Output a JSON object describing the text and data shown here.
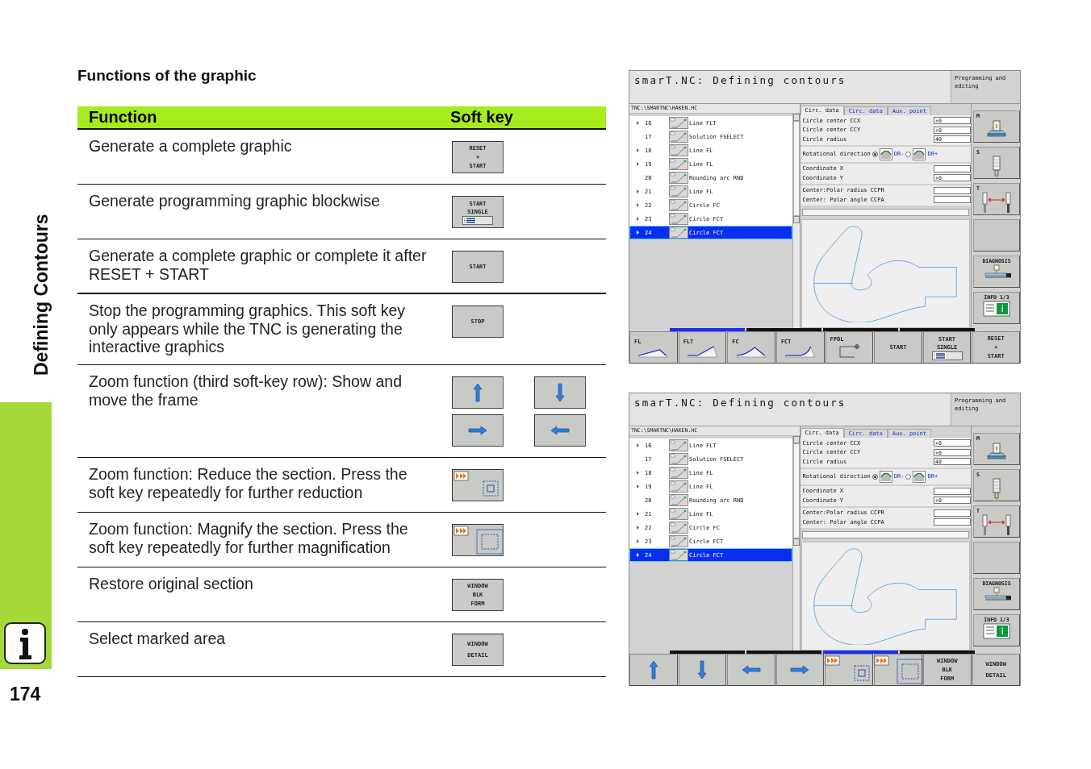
{
  "side_tab": {
    "title": "Defining Contours"
  },
  "page_number": "174",
  "section_title": "Functions of the graphic",
  "table": {
    "columns": [
      "Function",
      "Soft key"
    ],
    "rows": [
      {
        "function": "Generate a complete graphic",
        "softkeys": [
          {
            "kind": "text",
            "lines": [
              "RESET",
              "+",
              "START"
            ]
          }
        ]
      },
      {
        "function": "Generate programming graphic blockwise",
        "softkeys": [
          {
            "kind": "single",
            "lines": [
              "START",
              "SINGLE"
            ]
          }
        ]
      },
      {
        "function": "Generate a complete graphic or complete it after RESET + START",
        "softkeys": [
          {
            "kind": "text",
            "lines": [
              "START"
            ]
          }
        ]
      },
      {
        "function": "Stop the programming graphics. This soft key only appears while the TNC is generating the interactive graphics",
        "softkeys": [
          {
            "kind": "text",
            "lines": [
              "STOP"
            ]
          }
        ]
      },
      {
        "function": "Zoom function (third soft-key row): Show and move the frame",
        "softkeys": [
          {
            "kind": "up"
          },
          {
            "kind": "down"
          },
          {
            "kind": "right"
          },
          {
            "kind": "left"
          }
        ]
      },
      {
        "function": "Zoom function: Reduce the section. Press the soft key repeatedly for further reduction",
        "softkeys": [
          {
            "kind": "reduce"
          }
        ]
      },
      {
        "function": "Zoom function: Magnify the section. Press the soft key repeatedly for further magnification",
        "softkeys": [
          {
            "kind": "magnify"
          }
        ]
      },
      {
        "function": "Restore original section",
        "softkeys": [
          {
            "kind": "text",
            "lines": [
              "WINDOW",
              "BLK",
              "FORM"
            ]
          }
        ]
      },
      {
        "function": "Select marked area",
        "softkeys": [
          {
            "kind": "text",
            "lines": [
              "WINDOW",
              "DETAIL"
            ]
          }
        ]
      }
    ]
  },
  "screens": [
    {
      "title": "smarT.NC: Defining contours",
      "mode": "Programming and editing",
      "path": "TNC:\\SMARTNC\\HAKEN.HC",
      "blocks": [
        {
          "number": "16",
          "label": "Line FLT",
          "expandable": true,
          "selected": false
        },
        {
          "number": "17",
          "label": "Solution FSELECT",
          "expandable": false,
          "selected": false
        },
        {
          "number": "18",
          "label": "Line FL",
          "expandable": true,
          "selected": false
        },
        {
          "number": "19",
          "label": "Line FL",
          "expandable": true,
          "selected": false
        },
        {
          "number": "20",
          "label": "Rounding arc RND",
          "expandable": false,
          "selected": false
        },
        {
          "number": "21",
          "label": "Line FL",
          "expandable": true,
          "selected": false
        },
        {
          "number": "22",
          "label": "Circle FC",
          "expandable": true,
          "selected": false
        },
        {
          "number": "23",
          "label": "Circle FCT",
          "expandable": true,
          "selected": false
        },
        {
          "number": "24",
          "label": "Circle FCT",
          "expandable": true,
          "selected": true
        }
      ],
      "tabs": [
        {
          "label": "Circ. data",
          "selected": true
        },
        {
          "label": "Circ. data",
          "selected": false
        },
        {
          "label": "Aux. point",
          "selected": false
        }
      ],
      "field_groups": [
        [
          {
            "label": "Circle center CCX",
            "value": "+0"
          },
          {
            "label": "Circle center CCY",
            "value": "+0"
          },
          {
            "label": "Circle radius",
            "value": "40"
          }
        ],
        [
          {
            "label": "Coordinate X"
          },
          {
            "label": "Coordinate Y",
            "value": "+0"
          }
        ],
        [
          {
            "label": "Center:Polar radius CCPR"
          },
          {
            "label": "Center: Polar angle CCPA"
          }
        ]
      ],
      "rotation": {
        "label": "Rotational direction",
        "options": [
          {
            "label": "DR-",
            "selected": true
          },
          {
            "label": "DR+",
            "selected": false
          }
        ]
      },
      "side_keys": [
        {
          "kind": "machine",
          "label": "M"
        },
        {
          "kind": "spindle",
          "label": "S"
        },
        {
          "kind": "tool",
          "label": "T"
        },
        {
          "kind": "blank"
        },
        {
          "kind": "diagnosis",
          "label": "DIAGNOSIS"
        },
        {
          "kind": "info",
          "label": "INFO 1/3"
        }
      ],
      "softkey_rows": [
        {
          "selected": true
        },
        {
          "selected": false
        },
        {
          "selected": false
        },
        {
          "selected": false
        }
      ],
      "softkeys": [
        {
          "kind": "profile",
          "label": "FL"
        },
        {
          "kind": "profile",
          "label": "FLT"
        },
        {
          "kind": "profile",
          "label": "FC"
        },
        {
          "kind": "profile",
          "label": "FCT"
        },
        {
          "kind": "polar",
          "label": "FPOL"
        },
        {
          "kind": "text",
          "lines": [
            "START"
          ]
        },
        {
          "kind": "single",
          "lines": [
            "START",
            "SINGLE"
          ]
        },
        {
          "kind": "text",
          "lines": [
            "RESET",
            "+",
            "START"
          ]
        }
      ]
    },
    {
      "title": "smarT.NC: Defining contours",
      "mode": "Programming and editing",
      "path": "TNC:\\SMARTNC\\HAKEN.HC",
      "blocks": [
        {
          "number": "16",
          "label": "Line FLT",
          "expandable": true,
          "selected": false
        },
        {
          "number": "17",
          "label": "Solution FSELECT",
          "expandable": false,
          "selected": false
        },
        {
          "number": "18",
          "label": "Line FL",
          "expandable": true,
          "selected": false
        },
        {
          "number": "19",
          "label": "Line FL",
          "expandable": true,
          "selected": false
        },
        {
          "number": "20",
          "label": "Rounding arc RND",
          "expandable": false,
          "selected": false
        },
        {
          "number": "21",
          "label": "Line FL",
          "expandable": true,
          "selected": false
        },
        {
          "number": "22",
          "label": "Circle FC",
          "expandable": true,
          "selected": false
        },
        {
          "number": "23",
          "label": "Circle FCT",
          "expandable": true,
          "selected": false
        },
        {
          "number": "24",
          "label": "Circle FCT",
          "expandable": true,
          "selected": true
        }
      ],
      "tabs": [
        {
          "label": "Circ. data",
          "selected": true
        },
        {
          "label": "Circ. data",
          "selected": false
        },
        {
          "label": "Aux. point",
          "selected": false
        }
      ],
      "field_groups": [
        [
          {
            "label": "Circle center CCX",
            "value": "+0"
          },
          {
            "label": "Circle center CCY",
            "value": "+0"
          },
          {
            "label": "Circle radius",
            "value": "40"
          }
        ],
        [
          {
            "label": "Coordinate X"
          },
          {
            "label": "Coordinate Y",
            "value": "+0"
          }
        ],
        [
          {
            "label": "Center:Polar radius CCPR"
          },
          {
            "label": "Center: Polar angle CCPA"
          }
        ]
      ],
      "rotation": {
        "label": "Rotational direction",
        "options": [
          {
            "label": "DR-",
            "selected": true
          },
          {
            "label": "DR+",
            "selected": false
          }
        ]
      },
      "side_keys": [
        {
          "kind": "machine",
          "label": "M"
        },
        {
          "kind": "spindle",
          "label": "S"
        },
        {
          "kind": "tool",
          "label": "T"
        },
        {
          "kind": "blank"
        },
        {
          "kind": "diagnosis",
          "label": "DIAGNOSIS"
        },
        {
          "kind": "info",
          "label": "INFO 1/3"
        }
      ],
      "softkey_rows": [
        {
          "selected": false
        },
        {
          "selected": false
        },
        {
          "selected": true
        },
        {
          "selected": false
        }
      ],
      "softkeys": [
        {
          "kind": "up"
        },
        {
          "kind": "down"
        },
        {
          "kind": "left"
        },
        {
          "kind": "right"
        },
        {
          "kind": "reduce"
        },
        {
          "kind": "magnify"
        },
        {
          "kind": "text",
          "lines": [
            "WINDOW",
            "BLK",
            "FORM"
          ]
        },
        {
          "kind": "text",
          "lines": [
            "WINDOW",
            "DETAIL"
          ]
        }
      ]
    }
  ]
}
